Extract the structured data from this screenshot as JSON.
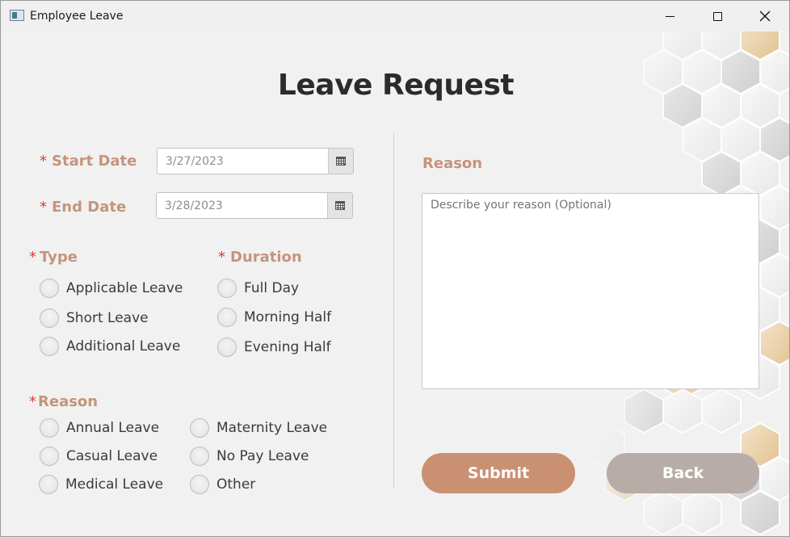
{
  "window": {
    "title": "Employee Leave",
    "controls": [
      "minimize-icon",
      "maximize-icon",
      "close-icon"
    ]
  },
  "page": {
    "title": "Leave Request"
  },
  "start_date": {
    "label": "Start Date",
    "value": "3/27/2023",
    "required_mark": "*"
  },
  "end_date": {
    "label": "End Date",
    "value": "3/28/2023",
    "required_mark": "*"
  },
  "type": {
    "label": "Type",
    "required_mark": "*",
    "options": [
      "Applicable Leave",
      "Short Leave",
      "Additional Leave"
    ]
  },
  "duration": {
    "label": "Duration",
    "required_mark": "*",
    "options": [
      "Full Day",
      "Morning Half",
      "Evening Half"
    ]
  },
  "reason_type": {
    "label": "Reason",
    "required_mark": "*",
    "options": [
      "Annual Leave",
      "Casual Leave",
      "Medical Leave",
      "Maternity Leave",
      "No Pay Leave",
      "Other"
    ]
  },
  "reason_text": {
    "label": "Reason",
    "placeholder": "Describe your reason (Optional)"
  },
  "buttons": {
    "submit": "Submit",
    "back": "Back"
  },
  "colors": {
    "accent": "#c5947a",
    "required": "#e03a3a",
    "submit_bg": "#c99072",
    "back_bg": "#b8aca8",
    "window_bg": "#f1f1f1"
  }
}
